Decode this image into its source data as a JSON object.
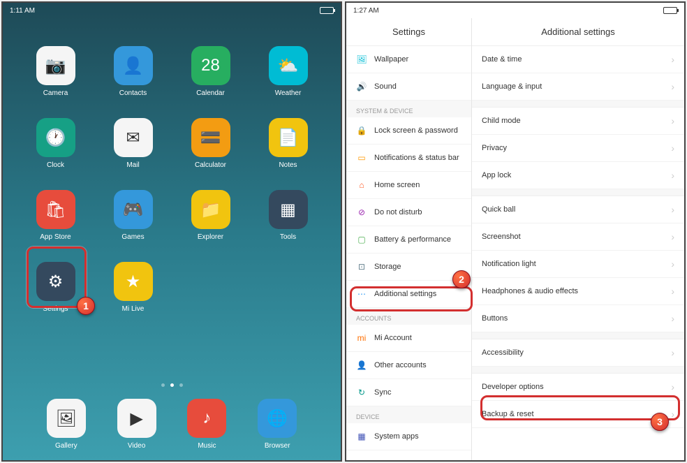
{
  "left": {
    "status_time": "1:11 AM",
    "apps": [
      {
        "label": "Camera",
        "icon": "camera-icon",
        "bg": "bg-white",
        "glyph": "📷"
      },
      {
        "label": "Contacts",
        "icon": "contacts-icon",
        "bg": "bg-blue",
        "glyph": "👤"
      },
      {
        "label": "Calendar",
        "icon": "calendar-icon",
        "bg": "bg-green",
        "glyph": "28"
      },
      {
        "label": "Weather",
        "icon": "weather-icon",
        "bg": "bg-lightblue",
        "glyph": "⛅"
      },
      {
        "label": "Clock",
        "icon": "clock-icon",
        "bg": "bg-teal",
        "glyph": "🕐"
      },
      {
        "label": "Mail",
        "icon": "mail-icon",
        "bg": "bg-white",
        "glyph": "✉"
      },
      {
        "label": "Calculator",
        "icon": "calculator-icon",
        "bg": "bg-orange",
        "glyph": "🟰"
      },
      {
        "label": "Notes",
        "icon": "notes-icon",
        "bg": "bg-yellow",
        "glyph": "📄"
      },
      {
        "label": "App Store",
        "icon": "appstore-icon",
        "bg": "bg-red",
        "glyph": "🛍"
      },
      {
        "label": "Games",
        "icon": "games-icon",
        "bg": "bg-blue",
        "glyph": "🎮"
      },
      {
        "label": "Explorer",
        "icon": "explorer-icon",
        "bg": "bg-yellow",
        "glyph": "📁"
      },
      {
        "label": "Tools",
        "icon": "tools-icon",
        "bg": "bg-dark",
        "glyph": "▦"
      },
      {
        "label": "Settings",
        "icon": "settings-icon",
        "bg": "bg-dark",
        "glyph": "⚙"
      },
      {
        "label": "Mi Live",
        "icon": "milive-icon",
        "bg": "bg-yellow",
        "glyph": "★"
      }
    ],
    "dock": [
      {
        "label": "Gallery",
        "icon": "gallery-icon",
        "bg": "bg-white",
        "glyph": "🖼"
      },
      {
        "label": "Video",
        "icon": "video-icon",
        "bg": "bg-white",
        "glyph": "▶"
      },
      {
        "label": "Music",
        "icon": "music-icon",
        "bg": "bg-red",
        "glyph": "♪"
      },
      {
        "label": "Browser",
        "icon": "browser-icon",
        "bg": "bg-blue",
        "glyph": "🌐"
      }
    ]
  },
  "right": {
    "status_time": "1:27 AM",
    "left_title": "Settings",
    "right_title": "Additional settings",
    "sections": {
      "top": [
        {
          "label": "Wallpaper",
          "icon": "wallpaper-icon",
          "glyph": "🖼",
          "color": "#00bcd4"
        },
        {
          "label": "Sound",
          "icon": "sound-icon",
          "glyph": "🔊",
          "color": "#03a9f4"
        }
      ],
      "system_header": "SYSTEM & DEVICE",
      "system": [
        {
          "label": "Lock screen & password",
          "icon": "lock-icon",
          "glyph": "🔒",
          "color": "#4caf50"
        },
        {
          "label": "Notifications & status bar",
          "icon": "notifications-icon",
          "glyph": "▭",
          "color": "#ff9800"
        },
        {
          "label": "Home screen",
          "icon": "home-icon",
          "glyph": "⌂",
          "color": "#ff5722"
        },
        {
          "label": "Do not disturb",
          "icon": "dnd-icon",
          "glyph": "⊘",
          "color": "#9c27b0"
        },
        {
          "label": "Battery & performance",
          "icon": "battery-icon",
          "glyph": "▢",
          "color": "#4caf50"
        },
        {
          "label": "Storage",
          "icon": "storage-icon",
          "glyph": "⊡",
          "color": "#607d8b"
        },
        {
          "label": "Additional settings",
          "icon": "more-icon",
          "glyph": "⋯",
          "color": "#2196f3"
        }
      ],
      "accounts_header": "ACCOUNTS",
      "accounts": [
        {
          "label": "Mi Account",
          "icon": "mi-icon",
          "glyph": "mi",
          "color": "#ff6f00"
        },
        {
          "label": "Other accounts",
          "icon": "accounts-icon",
          "glyph": "👤",
          "color": "#795548"
        },
        {
          "label": "Sync",
          "icon": "sync-icon",
          "glyph": "↻",
          "color": "#009688"
        }
      ],
      "device_header": "DEVICE",
      "device": [
        {
          "label": "System apps",
          "icon": "sysapps-icon",
          "glyph": "▦",
          "color": "#3f51b5"
        }
      ]
    },
    "detail": [
      {
        "label": "Date & time"
      },
      {
        "label": "Language & input"
      },
      {
        "spacer": true
      },
      {
        "label": "Child mode"
      },
      {
        "label": "Privacy"
      },
      {
        "label": "App lock"
      },
      {
        "spacer": true
      },
      {
        "label": "Quick ball"
      },
      {
        "label": "Screenshot"
      },
      {
        "label": "Notification light"
      },
      {
        "label": "Headphones & audio effects"
      },
      {
        "label": "Buttons"
      },
      {
        "spacer": true
      },
      {
        "label": "Accessibility"
      },
      {
        "spacer": true
      },
      {
        "label": "Developer options"
      },
      {
        "label": "Backup & reset"
      }
    ]
  },
  "callouts": {
    "one": "1",
    "two": "2",
    "three": "3"
  }
}
